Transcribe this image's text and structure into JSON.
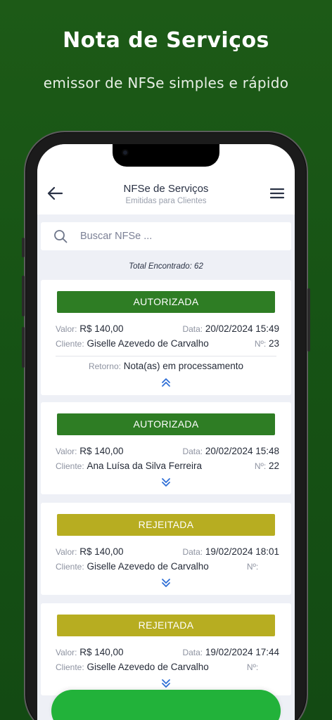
{
  "hero": {
    "title": "Nota de Serviços",
    "subtitle": "emissor de NFSe simples e rápido"
  },
  "header": {
    "title": "NFSe de Serviços",
    "subtitle": "Emitidas para Clientes",
    "back_icon": "arrow-left-icon",
    "menu_icon": "hamburger-menu-icon"
  },
  "search": {
    "placeholder": "Buscar NFSe ...",
    "value": ""
  },
  "total": "Total Encontrado: 62",
  "labels": {
    "valor": "Valor:",
    "data": "Data:",
    "cliente": "Cliente:",
    "numero": "Nº:",
    "retorno": "Retorno:"
  },
  "invoices": [
    {
      "status": "AUTORIZADA",
      "valor": "R$ 140,00",
      "data": "20/02/2024 15:49",
      "cliente": "Giselle Azevedo de Carvalho",
      "numero": "23",
      "retorno": "Nota(as) em processamento",
      "expanded": true
    },
    {
      "status": "AUTORIZADA",
      "valor": "R$ 140,00",
      "data": "20/02/2024 15:48",
      "cliente": "Ana Luísa da Silva Ferreira",
      "numero": "22",
      "expanded": false
    },
    {
      "status": "REJEITADA",
      "valor": "R$ 140,00",
      "data": "19/02/2024 18:01",
      "cliente": "Giselle Azevedo de Carvalho",
      "numero": "",
      "expanded": false
    },
    {
      "status": "REJEITADA",
      "valor": "R$ 140,00",
      "data": "19/02/2024 17:44",
      "cliente": "Giselle Azevedo de Carvalho",
      "numero": "",
      "expanded": false
    }
  ],
  "colors": {
    "autorizada": "#2e7d24",
    "rejeitada": "#b7ad21",
    "fab": "#22b23a",
    "chevron": "#2f6fd6",
    "background": "#175415"
  }
}
